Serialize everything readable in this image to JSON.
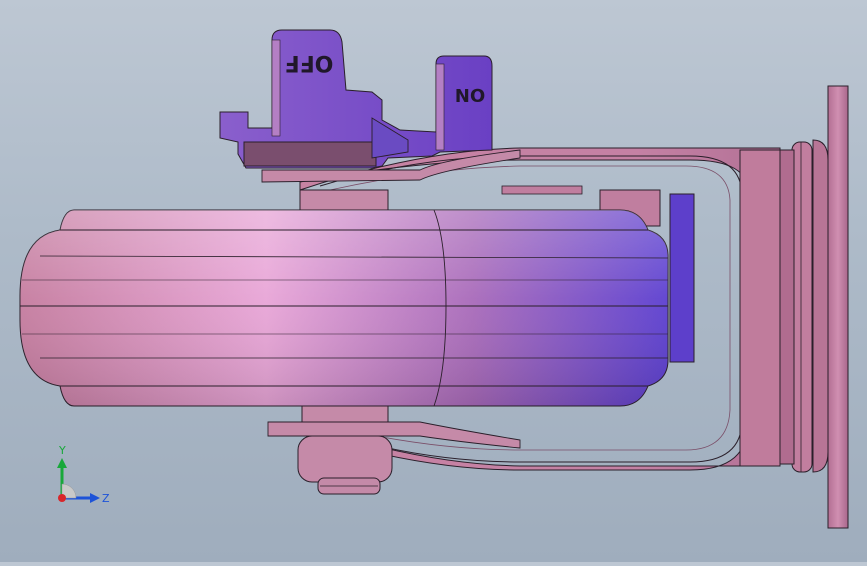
{
  "viewport": {
    "background_top": "#bdc7d3",
    "background_bottom": "#9fadbd",
    "part_color": "#c98aa8",
    "part_dark": "#a56f8c",
    "highlight_color": "#e9a9d6",
    "shadow_color": "#6a47c6",
    "edge_color": "#2a1f2a"
  },
  "labels": {
    "off_tab": "OFF",
    "on_tab": "ON"
  },
  "triad": {
    "y_label": "Y",
    "z_label": "Z",
    "y_color": "#18a83a",
    "z_color": "#1d53d8",
    "x_color": "#d8262a"
  }
}
